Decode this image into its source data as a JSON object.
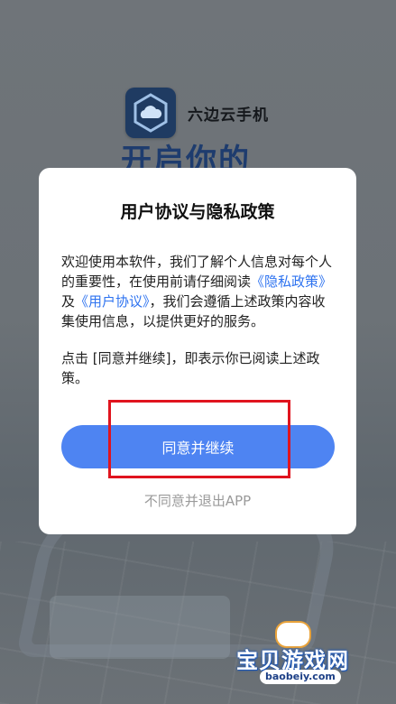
{
  "splash": {
    "app_name": "六边云手机",
    "headline": "开启你的"
  },
  "dialog": {
    "title": "用户协议与隐私政策",
    "body_intro": "欢迎使用本软件，我们了解个人信息对每个人的重要性，在使用前请仔细阅读",
    "privacy_link": "《隐私政策》",
    "and_word": "及",
    "terms_link": "《用户协议》",
    "body_rest": "，我们会遵循上述政策内容收集使用信息，以提供更好的服务。",
    "notice": "点击 [同意并继续]，即表示你已阅读上述政策。",
    "agree_button": "同意并继续",
    "decline_link": "不同意并退出APP"
  },
  "watermark": {
    "text": "宝贝游戏网",
    "url": "baobeiy.com"
  },
  "colors": {
    "primary_button": "#4e84f2",
    "link": "#2e73f0",
    "highlight_box": "#e0141e",
    "overlay_bg": "#6e7378"
  },
  "icons": [
    "cloud-hexagon-icon",
    "gamepad-icon"
  ]
}
